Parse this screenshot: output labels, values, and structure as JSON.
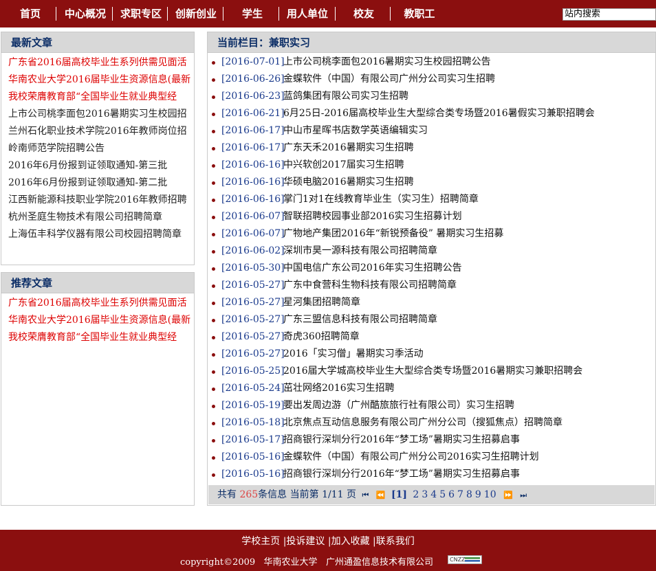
{
  "nav": {
    "items": [
      "首页",
      "中心概况",
      "求职专区",
      "创新创业",
      "学生",
      "用人单位",
      "校友",
      "教职工"
    ],
    "search_value": "站内搜索"
  },
  "sidebar": {
    "latest": {
      "title": "最新文章",
      "items": [
        "广东省2016届高校毕业生系列供需见面活",
        "华南农业大学2016届毕业生资源信息(最新",
        "我校荣膺教育部“全国毕业生就业典型经",
        "上市公司桃李面包2016暑期实习生校园招",
        "兰州石化职业技术学院2016年教师岗位招",
        "岭南师范学院招聘公告",
        "2016年6月份报到证领取通知-第三批",
        "2016年6月份报到证领取通知-第二批",
        "江西新能源科技职业学院2016年教师招聘",
        "杭州圣庭生物技术有限公司招聘简章",
        "上海伍丰科学仪器有限公司校园招聘简章"
      ]
    },
    "recommended": {
      "title": "推荐文章",
      "items": [
        "广东省2016届高校毕业生系列供需见面活",
        "华南农业大学2016届毕业生资源信息(最新",
        "我校荣膺教育部“全国毕业生就业典型经"
      ]
    }
  },
  "main": {
    "heading": "当前栏目：兼职实习",
    "articles": [
      {
        "date": "[2016-07-01]",
        "title": "上市公司桃李面包2016暑期实习生校园招聘公告"
      },
      {
        "date": "[2016-06-26]",
        "title": "金蝶软件（中国）有限公司广州分公司实习生招聘"
      },
      {
        "date": "[2016-06-23]",
        "title": "蓝鸽集团有限公司实习生招聘"
      },
      {
        "date": "[2016-06-21]",
        "title": "6月25日-2016届高校毕业生大型综合类专场暨2016暑假实习兼职招聘会"
      },
      {
        "date": "[2016-06-17]",
        "title": "中山市星晖书店数学英语编辑实习"
      },
      {
        "date": "[2016-06-17]",
        "title": "广东天禾2016暑期实习生招聘"
      },
      {
        "date": "[2016-06-16]",
        "title": "中兴软创2017届实习生招聘"
      },
      {
        "date": "[2016-06-16]",
        "title": "华硕电脑2016暑期实习生招聘"
      },
      {
        "date": "[2016-06-16]",
        "title": "掌门1对1在线教育毕业生（实习生）招聘简章"
      },
      {
        "date": "[2016-06-07]",
        "title": "智联招聘校园事业部2016实习生招募计划"
      },
      {
        "date": "[2016-06-07]",
        "title": "广物地产集团2016年“新锐预备役” 暑期实习生招募"
      },
      {
        "date": "[2016-06-02]",
        "title": "深圳市昊一源科技有限公司招聘简章"
      },
      {
        "date": "[2016-05-30]",
        "title": "中国电信广东公司2016年实习生招聘公告"
      },
      {
        "date": "[2016-05-27]",
        "title": "广东中食营科生物科技有限公司招聘简章"
      },
      {
        "date": "[2016-05-27]",
        "title": "星河集团招聘简章"
      },
      {
        "date": "[2016-05-27]",
        "title": "广东三盟信息科技有限公司招聘简章"
      },
      {
        "date": "[2016-05-27]",
        "title": "奇虎360招聘简章"
      },
      {
        "date": "[2016-05-27]",
        "title": "2016「实习僧」暑期实习季活动"
      },
      {
        "date": "[2016-05-25]",
        "title": "2016届大学城高校毕业生大型综合类专场暨2016暑期实习兼职招聘会"
      },
      {
        "date": "[2016-05-24]",
        "title": "茁壮网络2016实习生招聘"
      },
      {
        "date": "[2016-05-19]",
        "title": "要出发周边游（广州酷旅旅行社有限公司）实习生招聘"
      },
      {
        "date": "[2016-05-18]",
        "title": "北京焦点互动信息服务有限公司广州分公司（搜狐焦点）招聘简章"
      },
      {
        "date": "[2016-05-17]",
        "title": "招商银行深圳分行2016年“梦工场”暑期实习生招募启事"
      },
      {
        "date": "[2016-05-16]",
        "title": "金蝶软件（中国）有限公司广州分公司2016实习生招聘计划"
      },
      {
        "date": "[2016-05-16]",
        "title": "招商银行深圳分行2016年“梦工场”暑期实习生招募启事"
      }
    ],
    "pager": {
      "prefix": "共有",
      "total": "265",
      "total_suffix": "条信息",
      "current_label": "当前第",
      "current": "1/11",
      "page_suffix": "页",
      "first": "⏮",
      "prev": "⏪",
      "current_page": "[1]",
      "pages": [
        "2",
        "3",
        "4",
        "5",
        "6",
        "7",
        "8",
        "9",
        "10"
      ],
      "next": "⏩",
      "last": "⏭"
    }
  },
  "footer": {
    "links": [
      "学校主页",
      "|投诉建议",
      "|加入收藏",
      "|联系我们"
    ],
    "copyright": "copyright©2009   华南农业大学   广州通盈信息技术有限公司",
    "badge": "CNZZ"
  }
}
